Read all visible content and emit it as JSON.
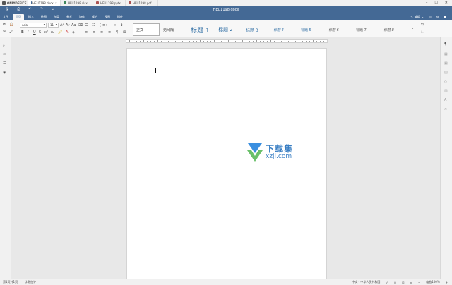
{
  "app": {
    "brand": "ONLYOFFICE",
    "doc_title": "HEU1198.docx"
  },
  "file_tabs": [
    {
      "name": "HEU1198.docx",
      "color": "#446995",
      "active": true
    },
    {
      "name": "HEU1198.xlsx",
      "color": "#40865c",
      "active": false
    },
    {
      "name": "HEU1198.pptx",
      "color": "#aa5252",
      "active": false
    },
    {
      "name": "HEU1198.pdf",
      "color": "#aa5252",
      "active": false
    }
  ],
  "window_controls": {
    "minimize": "–",
    "maximize": "☐",
    "close": "✕"
  },
  "quick_access": {
    "save": "🖫",
    "print": "⎙",
    "undo": "↶",
    "redo": "↷",
    "customize": "⌄"
  },
  "menu": {
    "items": [
      "文件",
      "首页",
      "插入",
      "绘图",
      "布局",
      "参考",
      "协作",
      "保护",
      "视图",
      "插件"
    ],
    "active_index": 1,
    "edit_label": "编辑",
    "edit_icon": "pencil-icon",
    "right_icons": [
      "folder-icon",
      "settings-icon",
      "user-icon"
    ]
  },
  "ribbon": {
    "font_name": "Arial",
    "font_size": "11",
    "format_buttons": [
      "B",
      "I",
      "U",
      "S",
      "x²",
      "x₂"
    ],
    "size_buttons": [
      "A⁺",
      "A⁻",
      "Aa"
    ],
    "list_buttons": [
      "☰",
      "☷",
      "⋮≡"
    ],
    "align_buttons": [
      "≡",
      "≡",
      "≡",
      "≡"
    ],
    "pilcrow": "¶"
  },
  "styles": [
    "正文",
    "无间隔",
    "标题 1",
    "标题 2",
    "标题 3",
    "标题 4",
    "标题 5",
    "标题 6",
    "标题 7",
    "标题 8"
  ],
  "watermark": {
    "text": "下载集",
    "url": "xzji.com"
  },
  "left_tools": [
    "search-icon",
    "comments-icon",
    "navigation-icon",
    "spellcheck-icon"
  ],
  "right_tools": [
    "paragraph-settings-icon",
    "table-settings-icon",
    "image-settings-icon",
    "header-footer-icon",
    "shape-settings-icon",
    "chart-settings-icon",
    "text-art-icon",
    "signature-icon"
  ],
  "status": {
    "page_info": "第1页共1页",
    "word_count": "字数统计",
    "language": "中文 - 中华人民共和国",
    "spell": "✓",
    "track": "⊙",
    "fit_page": "⊡",
    "fit_width": "⇔",
    "zoom": "缩放100%"
  }
}
